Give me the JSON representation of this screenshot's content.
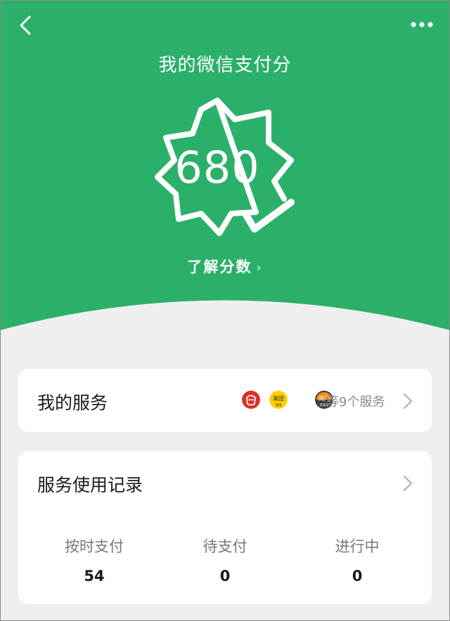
{
  "header": {
    "title": "我的微信支付分",
    "score": "680",
    "learn_label": "了解分数",
    "learn_chevron": "›",
    "bg_color": "#2bb06a"
  },
  "services_card": {
    "title": "我的服务",
    "more_text": "等9个服务",
    "icons": [
      {
        "name": "pinduoduo-icon",
        "color": "#e02e24"
      },
      {
        "name": "meituan-icon",
        "color": "#ffd000",
        "text_top": "美团",
        "text_bottom": "充电"
      },
      {
        "name": "orange-service-icon",
        "color": "#3a3a3a",
        "text_top": "闹门",
        "text_bottom": "充电宝"
      }
    ]
  },
  "records_card": {
    "title": "服务使用记录",
    "stats": [
      {
        "label": "按时支付",
        "value": "54"
      },
      {
        "label": "待支付",
        "value": "0"
      },
      {
        "label": "进行中",
        "value": "0"
      }
    ]
  }
}
